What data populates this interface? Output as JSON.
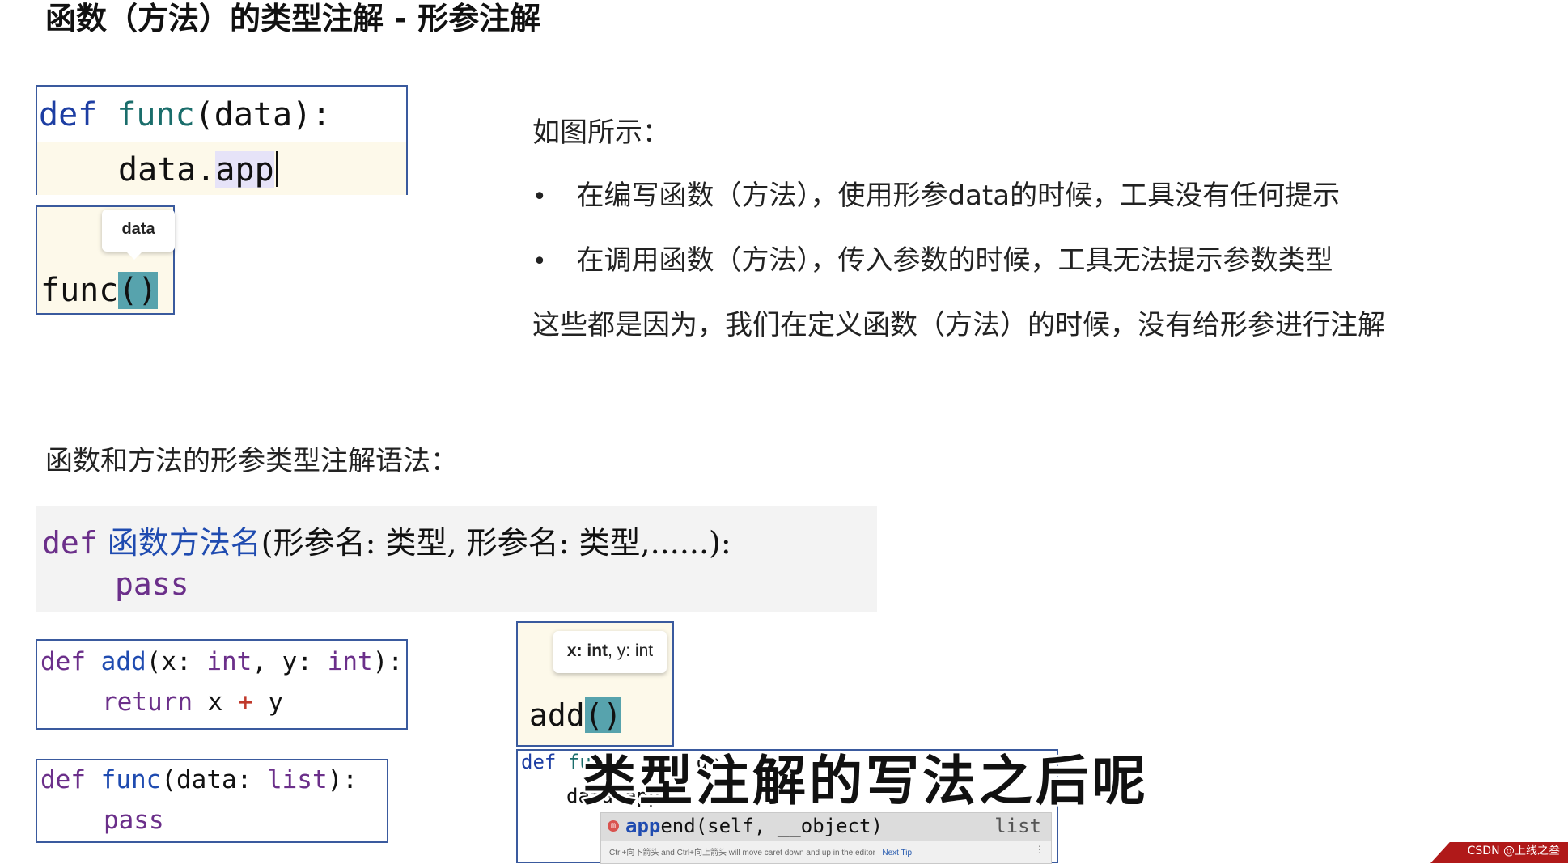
{
  "title": "函数（方法）的类型注解 - 形参注解",
  "example_box": {
    "line1": {
      "def": "def",
      "name": "func",
      "rest": "(data):"
    },
    "line2": {
      "pre": "data.",
      "typed": "app"
    }
  },
  "func_call_box": {
    "tooltip": "data",
    "call_name": "func",
    "parens": "()"
  },
  "description": {
    "intro": "如图所示：",
    "bullets": [
      "在编写函数（方法），使用形参data的时候，工具没有任何提示",
      "在调用函数（方法），传入参数的时候，工具无法提示参数类型"
    ],
    "conclusion": "这些都是因为，我们在定义函数（方法）的时候，没有给形参进行注解"
  },
  "syntax_heading": "函数和方法的形参类型注解语法：",
  "syntax_box": {
    "def": "def",
    "name": "函数方法名",
    "params": "(形参名: 类型, 形参名: 类型,......):",
    "body": "pass"
  },
  "add_box": {
    "def": "def",
    "name": "add",
    "open": "(x: ",
    "t1": "int",
    "mid": ", y: ",
    "t2": "int",
    "close": "):",
    "ret": "return",
    "expr": " x ",
    "op": "+",
    "expr2": " y"
  },
  "func_list_box": {
    "def": "def",
    "name": "func",
    "open": "(data: ",
    "type": "list",
    "close": "):",
    "body": "pass"
  },
  "add_tip_box": {
    "tooltip_bold": "x: int",
    "tooltip_rest": ", y: int",
    "call_name": "add",
    "parens": "()"
  },
  "completion_box": {
    "line1_def": "def",
    "line1_name": "fu",
    "line1_rest": "da",
    "line2": "data.app",
    "item_icon": "m",
    "item_match": "app",
    "item_rest": "end(self, __object)",
    "item_type": "list",
    "hint": "Ctrl+向下箭头 and Ctrl+向上箭头 will move caret down and up in the editor",
    "next_tip": "Next Tip",
    "more": "⋮"
  },
  "subtitle": "类型注解的写法之后呢",
  "watermark": "CSDN @上线之叁"
}
